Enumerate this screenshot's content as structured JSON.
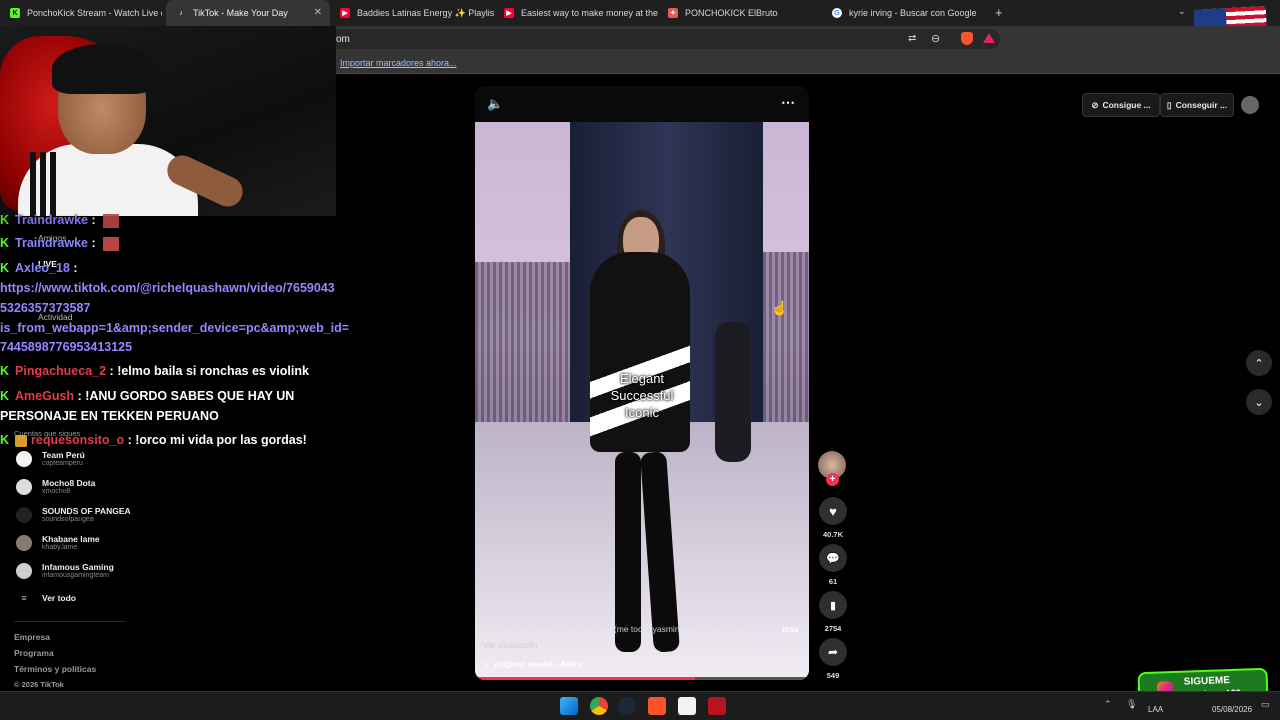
{
  "browser": {
    "tabs": [
      {
        "title": "PonchoKick Stream - Watch Live on K",
        "icon_color": "#53fc18",
        "icon_char": "K"
      },
      {
        "title": "TikTok - Make Your Day",
        "icon_color": "#ffffff",
        "icon_char": "♪",
        "active": true
      },
      {
        "title": "Baddies Latinas Energy ✨ Playlist [T",
        "icon_color": "#ff0033",
        "icon_char": "▶"
      },
      {
        "title": "Easiest way to make money at the ca",
        "icon_color": "#ff0033",
        "icon_char": "▶"
      },
      {
        "title": "PONCHOKICK ElBruto",
        "icon_color": "#e85a4f",
        "icon_char": "✦"
      },
      {
        "title": "kyrie irving - Buscar con Google",
        "icon_color": "#4285f4",
        "icon_char": "G"
      }
    ],
    "new_tab_label": "+",
    "tab_close_label": "✕",
    "url_fragment": "om",
    "bookmark_import_link": "Importar marcadores ahora..."
  },
  "tiktok": {
    "sidebar": {
      "amigos_label": "Amigos",
      "live_label": "LIVE",
      "actividad_label": "Actividad",
      "cuentas_label": "Cuentas que sigues",
      "following": [
        {
          "name": "Team Perú",
          "handle": "copteamperu",
          "verified": true
        },
        {
          "name": "Mocho8 Dota",
          "handle": "xmocho8",
          "verified": false
        },
        {
          "name": "SOUNDS OF PANGEA",
          "handle": "soundsofpangea",
          "verified": false
        },
        {
          "name": "Khabane lame",
          "handle": "khaby.lame",
          "verified": true
        },
        {
          "name": "Infamous Gaming",
          "handle": "infamousgamingteam",
          "verified": false
        }
      ],
      "ver_todo_label": "Ver todo",
      "footer": [
        "Empresa",
        "Programa",
        "Términos y políticas",
        "© 2026 TikTok"
      ]
    },
    "header_buttons": {
      "coins_label": "Consigue ...",
      "app_label": "Conseguir ..."
    },
    "video": {
      "overlay_text_lines": [
        "Elegant",
        "Successful",
        "Iconic"
      ],
      "description": "Another one since u guys love her (me too) #yasminaijnaldura #model ...",
      "more_label": "más",
      "translate_label": "Ver traducción",
      "sound_label": "original sound - Astro",
      "progress_fraction": 0.66
    },
    "actions": {
      "likes": "40.7K",
      "comments": "61",
      "saves": "2754",
      "shares": "549"
    }
  },
  "chat": {
    "messages": [
      {
        "user": "Traindrawke",
        "text": "",
        "color": "purple",
        "emote": true
      },
      {
        "user": "Traindrawke",
        "text": "",
        "color": "purple",
        "emote": true
      },
      {
        "user": "Axleo_18",
        "text": "",
        "color": "purple",
        "emote": false
      },
      {
        "link_lines": [
          "https://www.tiktok.com/@richelquashawn/video/7659043",
          "5326357373587",
          "is_from_webapp=1&amp;sender_device=pc&amp;web_id=",
          "7445898776953413125"
        ]
      },
      {
        "user": "Pingachueca_2",
        "text": "!elmo baila si ronchas es violink",
        "color": "red",
        "emote": false
      },
      {
        "user": "AmeGush",
        "text": "!ANU GORDO SABES QUE HAY UN",
        "continuation": "PERSONAJE EN TEKKEN PERUANO",
        "color": "red",
        "emote": false
      },
      {
        "user": "requesonsito_o",
        "text": "!orco mi vida por las gordas!",
        "color": "red",
        "emote": false
      }
    ],
    "separator": ":"
  },
  "overlay": {
    "follow_title": "SIGUEME",
    "follow_handle": "ponchogg123"
  },
  "taskbar": {
    "lang": "LAA",
    "date": "05/08/2026"
  },
  "colors": {
    "kick_green": "#53fc18",
    "tiktok_red": "#fe2c55",
    "chat_purple": "#8b82ff",
    "chat_red": "#e23a4b"
  }
}
